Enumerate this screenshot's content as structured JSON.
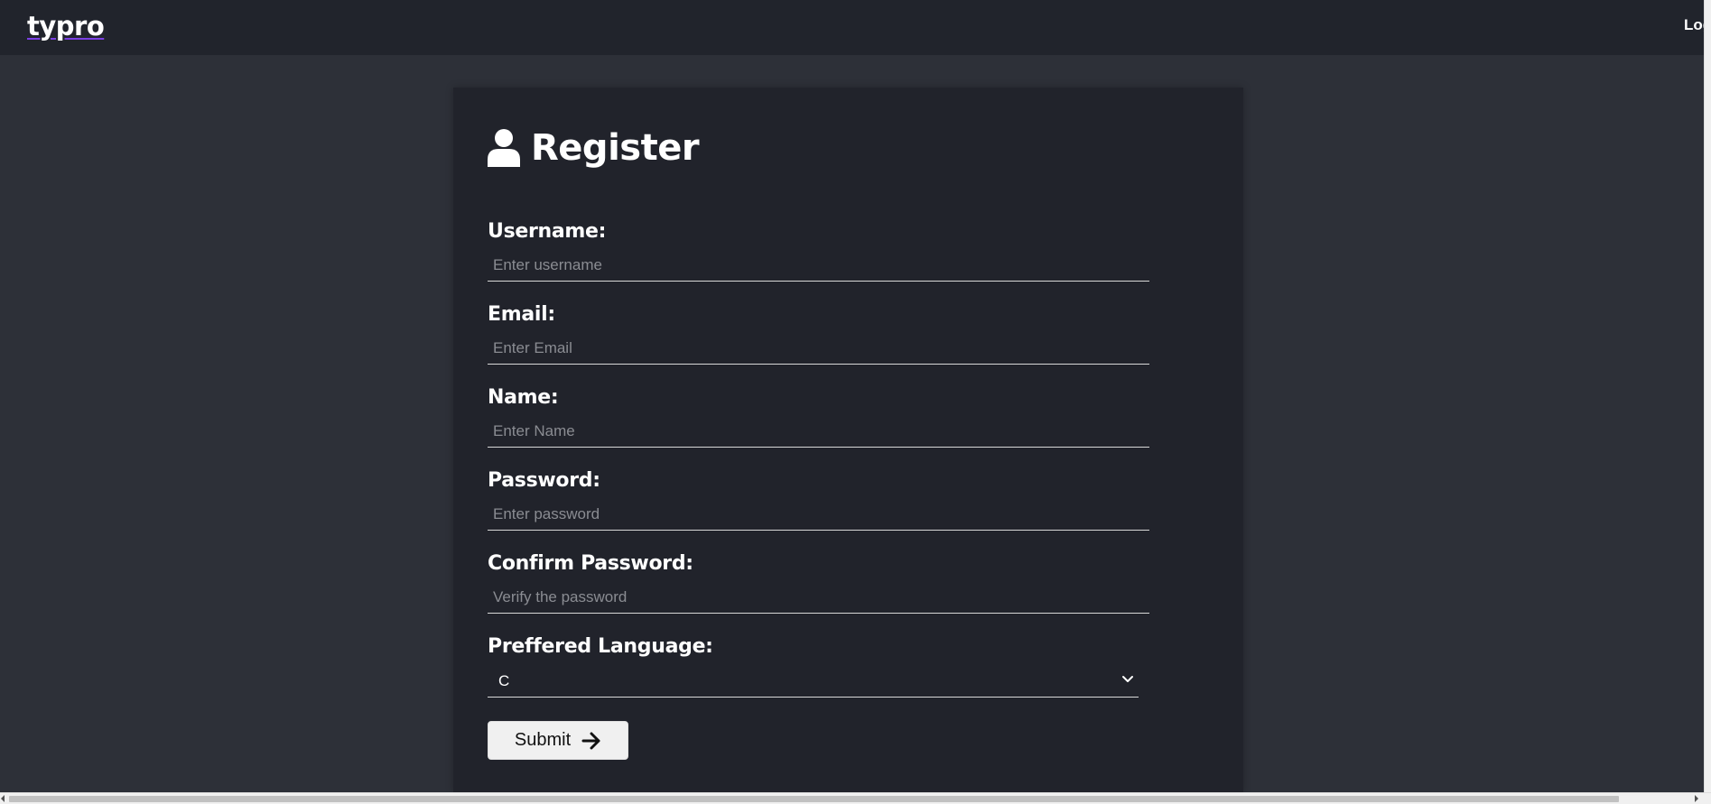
{
  "navbar": {
    "logo": "typro",
    "login_label": "Log"
  },
  "form": {
    "title": "Register",
    "fields": [
      {
        "label": "Username:",
        "placeholder": "Enter username"
      },
      {
        "label": "Email:",
        "placeholder": "Enter Email"
      },
      {
        "label": "Name:",
        "placeholder": "Enter Name"
      },
      {
        "label": "Password:",
        "placeholder": "Enter password"
      },
      {
        "label": "Confirm Password:",
        "placeholder": "Verify the password"
      }
    ],
    "language": {
      "label": "Preffered Language:",
      "selected": "C"
    },
    "submit_label": "Submit"
  },
  "icons": {
    "title_icon": "user-icon",
    "submit_icon": "arrow-right-icon",
    "select_icon": "chevron-down-icon"
  },
  "colors": {
    "page_bg": "#2d3038",
    "card_bg": "#21232b",
    "navbar_bg": "#21242c",
    "logo_underline": "#7b3fe4"
  }
}
